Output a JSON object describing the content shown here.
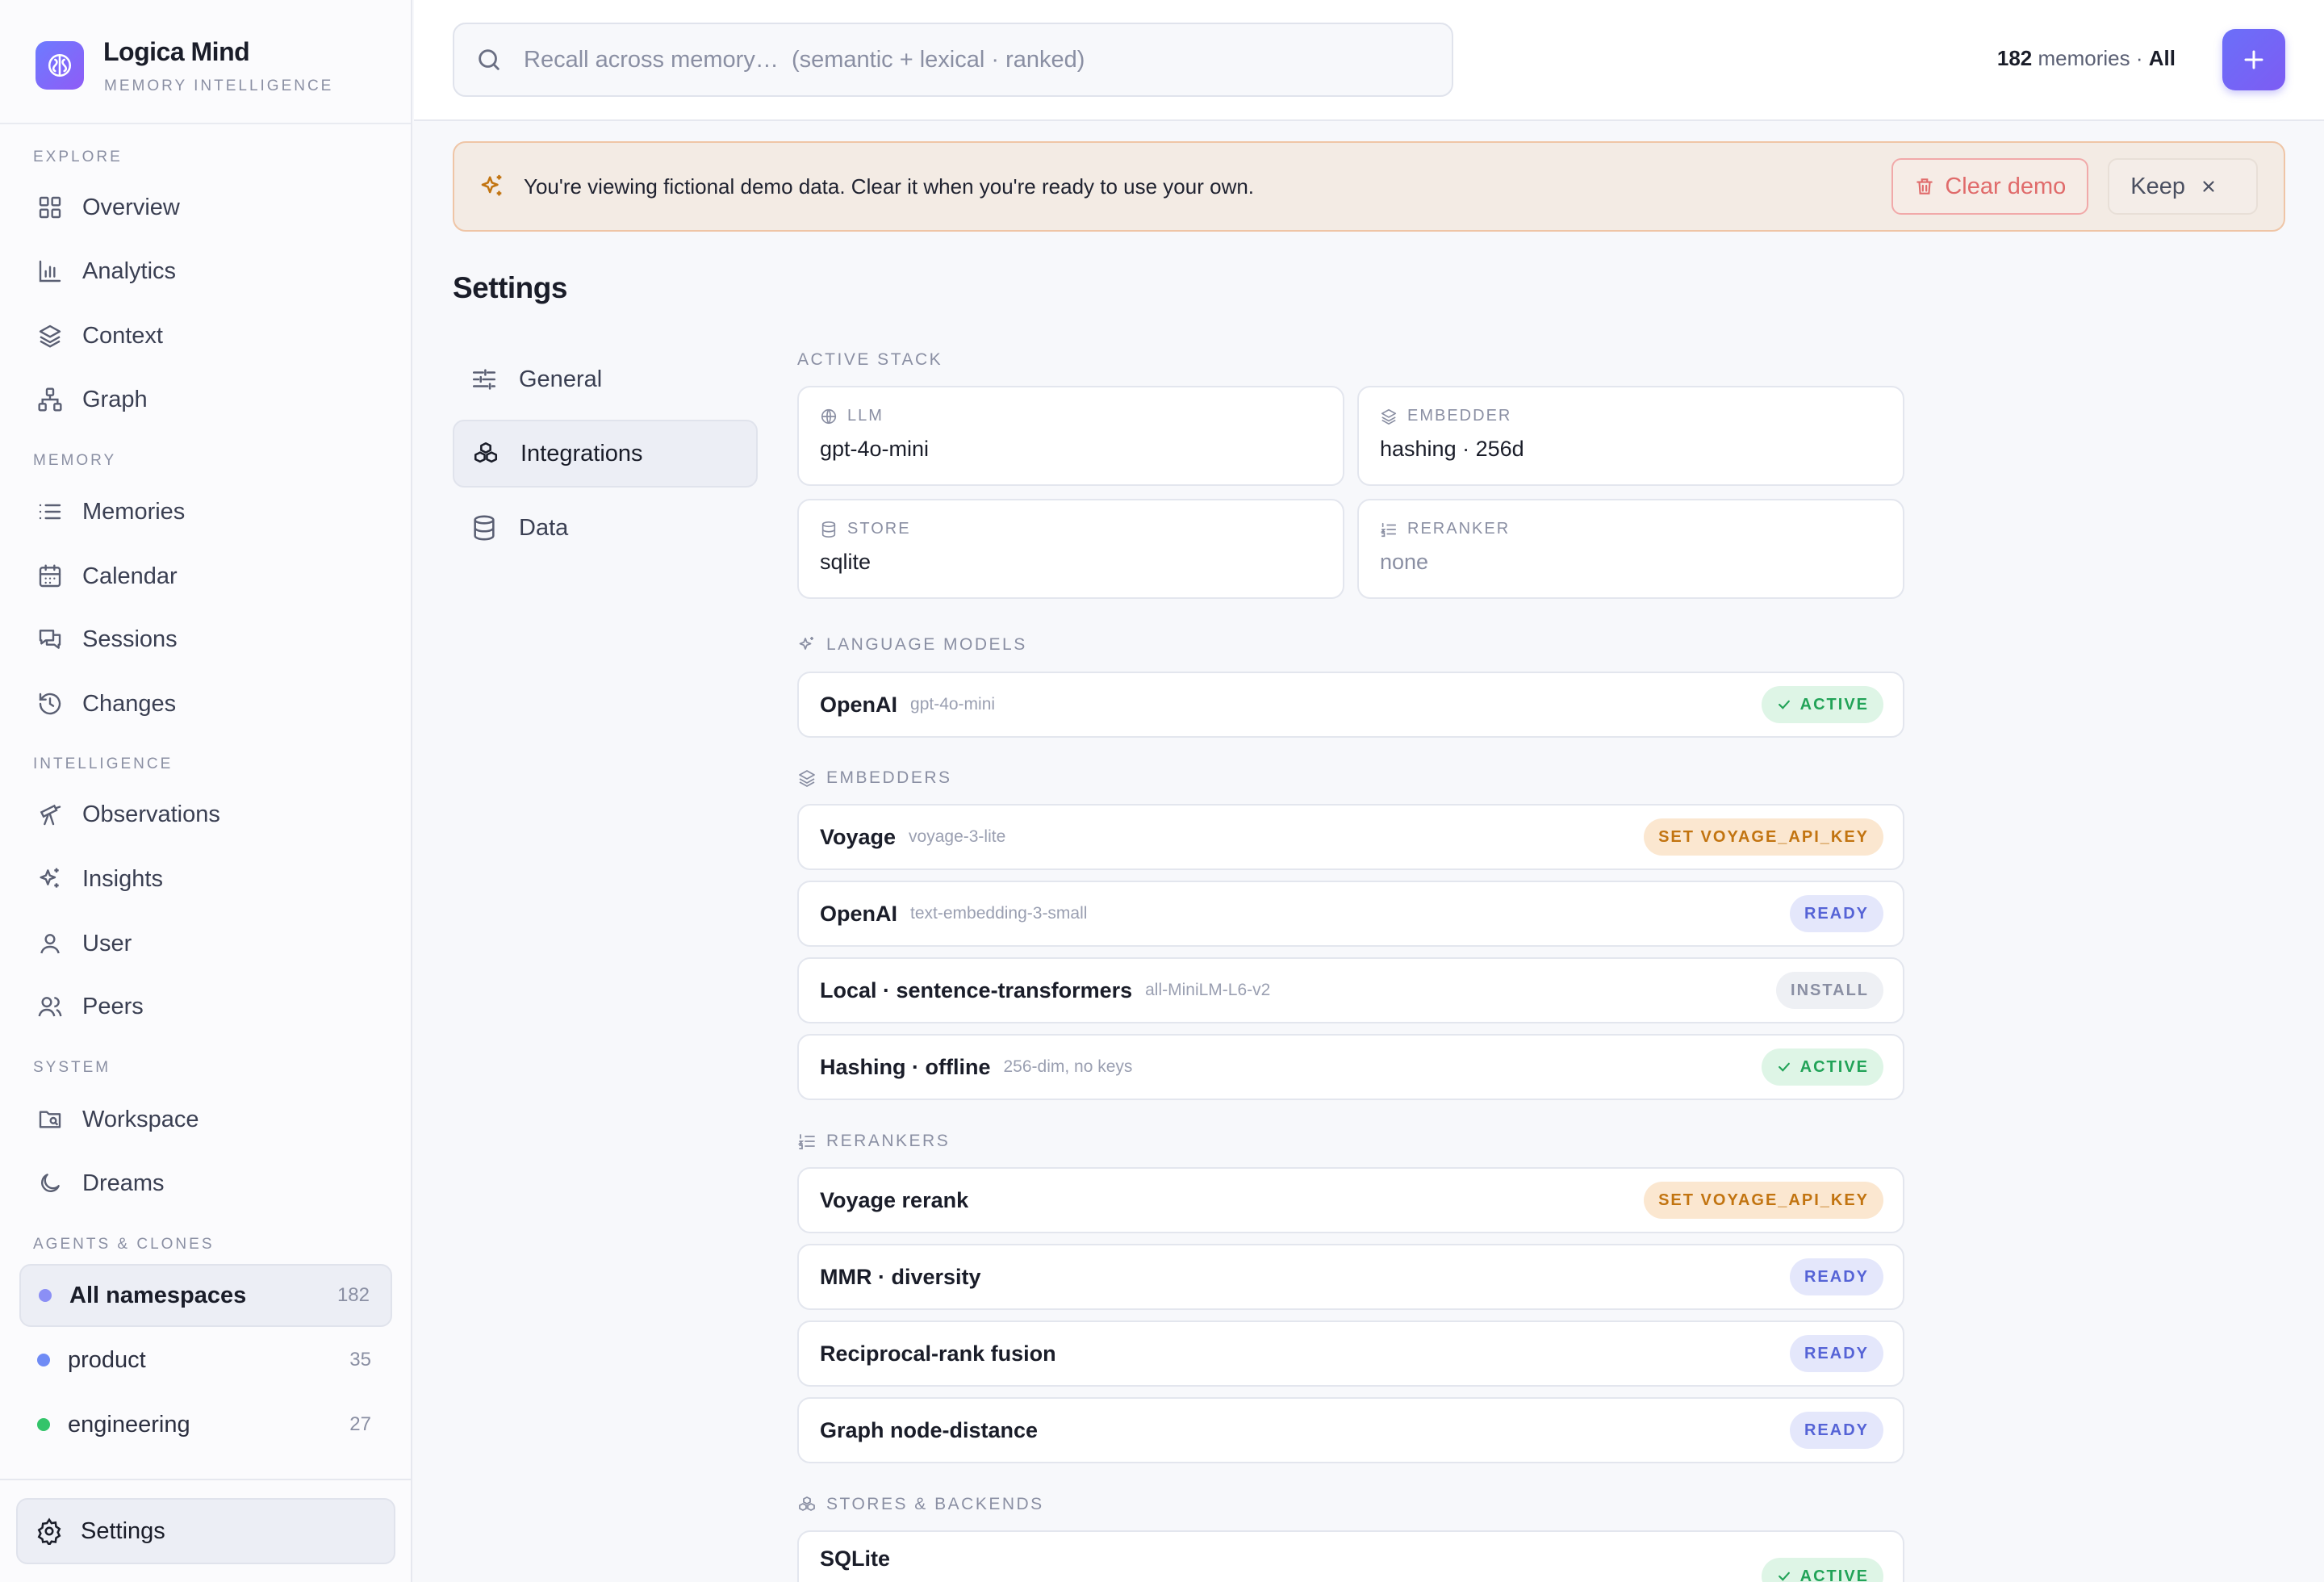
{
  "brand": {
    "name": "Logica Mind",
    "subtitle": "MEMORY INTELLIGENCE"
  },
  "sidebar": {
    "sections": [
      {
        "label": "EXPLORE"
      },
      {
        "label": "MEMORY"
      },
      {
        "label": "INTELLIGENCE"
      },
      {
        "label": "SYSTEM"
      },
      {
        "label": "AGENTS & CLONES"
      }
    ],
    "items": [
      {
        "label": "Overview",
        "icon": "grid-icon"
      },
      {
        "label": "Analytics",
        "icon": "bar-chart-icon"
      },
      {
        "label": "Context",
        "icon": "layers-icon"
      },
      {
        "label": "Graph",
        "icon": "network-icon"
      },
      {
        "label": "Memories",
        "icon": "list-icon"
      },
      {
        "label": "Calendar",
        "icon": "calendar-icon"
      },
      {
        "label": "Sessions",
        "icon": "chat-icon"
      },
      {
        "label": "Changes",
        "icon": "history-icon"
      },
      {
        "label": "Observations",
        "icon": "telescope-icon"
      },
      {
        "label": "Insights",
        "icon": "sparkles-icon"
      },
      {
        "label": "User",
        "icon": "user-icon"
      },
      {
        "label": "Peers",
        "icon": "users-icon"
      },
      {
        "label": "Workspace",
        "icon": "folder-icon"
      },
      {
        "label": "Dreams",
        "icon": "moon-icon"
      }
    ],
    "namespaces": [
      {
        "label": "All namespaces",
        "count": "182",
        "color": "#8b8ff5"
      },
      {
        "label": "product",
        "count": "35",
        "color": "#6f8bf5"
      },
      {
        "label": "engineering",
        "count": "27",
        "color": "#33c46a"
      }
    ],
    "footer": {
      "settings_label": "Settings"
    }
  },
  "topbar": {
    "search_placeholder": "Recall across memory…  (semantic + lexical · ranked)",
    "memory_count": "182",
    "memory_word": "memories ·",
    "scope": "All"
  },
  "banner": {
    "text": "You're viewing fictional demo data. Clear it when you're ready to use your own.",
    "clear_label": "Clear demo",
    "keep_label": "Keep"
  },
  "page": {
    "title": "Settings"
  },
  "tabs": [
    {
      "label": "General"
    },
    {
      "label": "Integrations"
    },
    {
      "label": "Data"
    }
  ],
  "active_stack": {
    "label": "ACTIVE STACK",
    "cards": [
      {
        "key": "LLM",
        "value": "gpt-4o-mini"
      },
      {
        "key": "EMBEDDER",
        "value": "hashing · 256d"
      },
      {
        "key": "STORE",
        "value": "sqlite"
      },
      {
        "key": "RERANKER",
        "value": "none"
      }
    ]
  },
  "language_models": {
    "label": "LANGUAGE MODELS",
    "rows": [
      {
        "name": "OpenAI",
        "sub": "gpt-4o-mini",
        "badge": "ACTIVE"
      }
    ]
  },
  "embedders": {
    "label": "EMBEDDERS",
    "rows": [
      {
        "name": "Voyage",
        "sub": "voyage-3-lite",
        "badge": "SET VOYAGE_API_KEY"
      },
      {
        "name": "OpenAI",
        "sub": "text-embedding-3-small",
        "badge": "READY"
      },
      {
        "name": "Local · sentence-transformers",
        "sub": "all-MiniLM-L6-v2",
        "badge": "INSTALL"
      },
      {
        "name": "Hashing · offline",
        "sub": "256-dim, no keys",
        "badge": "ACTIVE"
      }
    ]
  },
  "rerankers": {
    "label": "RERANKERS",
    "rows": [
      {
        "name": "Voyage rerank",
        "badge": "SET VOYAGE_API_KEY"
      },
      {
        "name": "MMR · diversity",
        "badge": "READY"
      },
      {
        "name": "Reciprocal-rank fusion",
        "badge": "READY"
      },
      {
        "name": "Graph node-distance",
        "badge": "READY"
      }
    ]
  },
  "stores": {
    "label": "STORES & BACKENDS",
    "rows": [
      {
        "name": "SQLite",
        "badge": "ACTIVE"
      }
    ]
  }
}
